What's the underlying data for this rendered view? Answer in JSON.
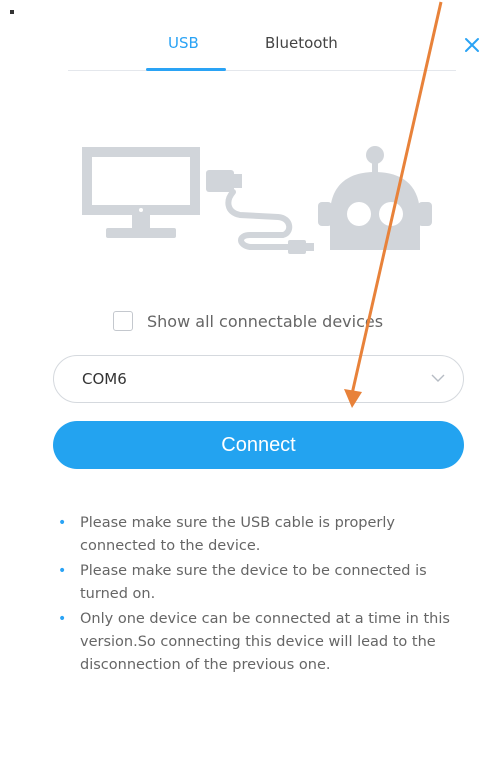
{
  "tabs": [
    {
      "label": "USB",
      "active": true
    },
    {
      "label": "Bluetooth",
      "active": false
    }
  ],
  "close_icon": "close-icon",
  "illustration": {
    "icons": [
      "monitor-icon",
      "usb-cable-icon",
      "robot-icon"
    ],
    "color": "#d1d5da"
  },
  "checkbox": {
    "label": "Show all connectable devices",
    "checked": false
  },
  "port_select": {
    "value": "COM6",
    "icon": "chevron-down-icon"
  },
  "connect_button": {
    "label": "Connect"
  },
  "notes": [
    "Please make sure the USB cable is properly connected to the device.",
    "Please make sure the device to be connected is turned on.",
    "Only one device can be connected at a time in this version.So connecting this device will lead to the disconnection of the previous one."
  ],
  "colors": {
    "accent": "#23a3f0",
    "annotation_arrow": "#e8823a"
  }
}
